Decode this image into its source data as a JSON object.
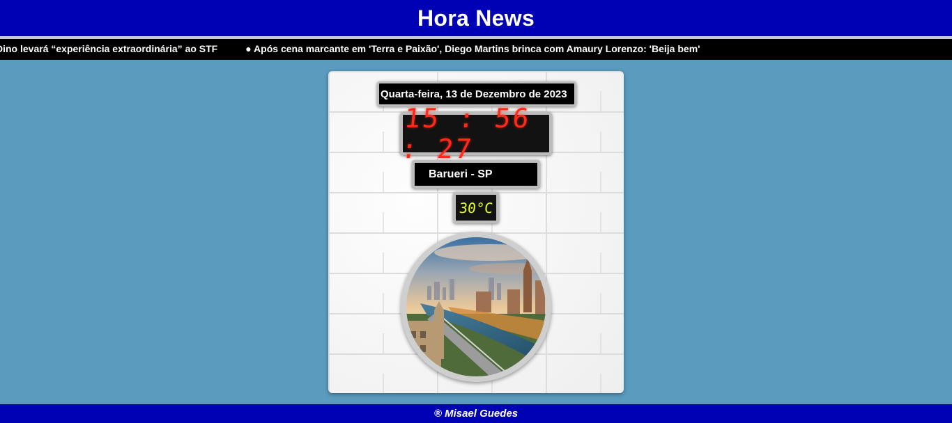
{
  "header": {
    "title": "Hora News"
  },
  "ticker": {
    "items": [
      "Dino levará “experiência extraordinária” ao STF",
      "● Após cena marcante em 'Terra e Paixão', Diego Martins brinca com Amaury Lorenzo: 'Beija bem'"
    ]
  },
  "widget": {
    "date": "Quarta-feira, 13 de Dezembro de 2023",
    "time": "15:56:27",
    "location": "Barueri - SP",
    "temperature": "30°C",
    "image_alt": "city-river-illustration"
  },
  "footer": {
    "text": "® Misael Guedes"
  },
  "colors": {
    "header_bg": "#0000b4",
    "page_bg": "#5a9bbe",
    "clock_digits": "#ff2a1a",
    "temp_digits": "#e6ff1a"
  }
}
